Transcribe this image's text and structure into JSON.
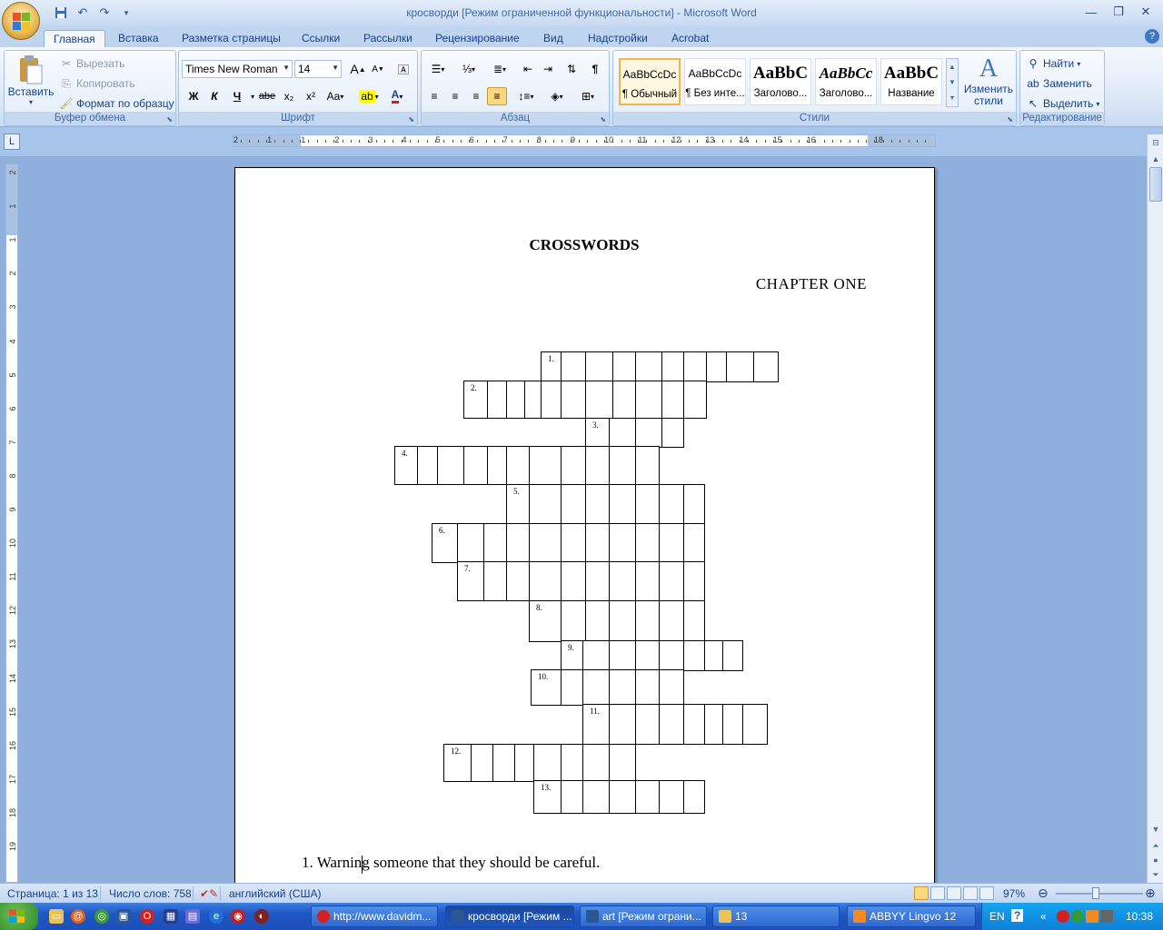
{
  "window": {
    "title": "кросворди [Режим ограниченной функциональности] - Microsoft Word"
  },
  "quick_access": [
    "save-icon",
    "undo-icon",
    "redo-icon",
    "customize-icon"
  ],
  "tabs": [
    "Главная",
    "Вставка",
    "Разметка страницы",
    "Ссылки",
    "Рассылки",
    "Рецензирование",
    "Вид",
    "Надстройки",
    "Acrobat"
  ],
  "active_tab": "Главная",
  "ribbon": {
    "clipboard": {
      "paste": "Вставить",
      "cut": "Вырезать",
      "copy": "Копировать",
      "format_painter": "Формат по образцу",
      "label": "Буфер обмена"
    },
    "font": {
      "name": "Times New Roman",
      "size": "14",
      "label": "Шрифт",
      "bold": "Ж",
      "italic": "К",
      "underline": "Ч",
      "strike": "abe",
      "subscript": "x₂",
      "superscript": "x²",
      "case": "Aa",
      "grow": "A",
      "shrink": "A"
    },
    "paragraph": {
      "label": "Абзац"
    },
    "styles": {
      "label": "Стили",
      "items": [
        {
          "sample": "AaBbCcDc",
          "name": "¶ Обычный"
        },
        {
          "sample": "AaBbCcDc",
          "name": "¶ Без инте..."
        },
        {
          "sample": "AaBbC",
          "name": "Заголово..."
        },
        {
          "sample": "AaBbCc",
          "name": "Заголово..."
        },
        {
          "sample": "AaBbC",
          "name": "Название"
        }
      ],
      "change_styles": "Изменить стили"
    },
    "editing": {
      "label": "Редактирование",
      "find": "Найти",
      "replace": "Заменить",
      "select": "Выделить"
    }
  },
  "ruler": {
    "h_numbers": [
      "2",
      "1",
      "1",
      "2",
      "3",
      "4",
      "5",
      "6",
      "7",
      "8",
      "9",
      "10",
      "11",
      "12",
      "13",
      "14",
      "15",
      "16",
      "18"
    ],
    "v_numbers": [
      "2",
      "1",
      "1",
      "2",
      "3",
      "4",
      "5",
      "6",
      "7",
      "8",
      "9",
      "10",
      "11",
      "12",
      "13",
      "14",
      "15",
      "16",
      "17",
      "18",
      "19"
    ]
  },
  "document": {
    "title": "CROSSWORDS",
    "chapter": "CHAPTER   ONE",
    "crossword_numbers": [
      "1.",
      "2.",
      "3.",
      "4.",
      "5.",
      "6.",
      "7.",
      "8.",
      "9.",
      "10.",
      "11.",
      "12.",
      "13."
    ],
    "clue_1": "1. Warning someone that they should be careful."
  },
  "status": {
    "page": "Страница: 1 из 13",
    "words": "Число слов: 758",
    "language": "английский (США)",
    "zoom": "97%"
  },
  "taskbar": {
    "tasks": [
      {
        "label": "http://www.davidm...",
        "color": "#d32020"
      },
      {
        "label": "кросворди [Режим ...",
        "color": "#2b5796"
      },
      {
        "label": "art [Режим ограни...",
        "color": "#2b5796"
      },
      {
        "label": "13",
        "color": "#e8c25a"
      },
      {
        "label": "ABBYY Lingvo 12",
        "color": "#f08a24"
      }
    ],
    "lang": "EN",
    "clock": "10:38"
  },
  "colors": {
    "ribbon_bg": "#dbe7f6",
    "doc_bg": "#8fb0dc",
    "taskbar": "#1f57c4"
  }
}
